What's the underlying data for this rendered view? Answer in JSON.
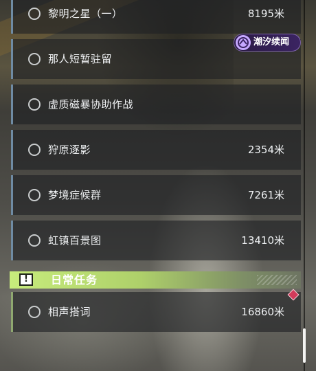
{
  "badge": {
    "label": "潮汐续闻",
    "icon": "tide-event-icon"
  },
  "tasks": [
    {
      "name": "黎明之星（一）",
      "distance": "8195米"
    },
    {
      "name": "那人短暂驻留",
      "distance": ""
    },
    {
      "name": "虚质磁暴协助作战",
      "distance": ""
    },
    {
      "name": "狩原逐影",
      "distance": "2354米"
    },
    {
      "name": "梦境症候群",
      "distance": "7261米"
    },
    {
      "name": "虹镇百景图",
      "distance": "13410米"
    }
  ],
  "daily_section": {
    "title": "日常任务",
    "icon_mark": "!",
    "tasks": [
      {
        "name": "相声搭词",
        "distance": "16860米"
      }
    ]
  },
  "colors": {
    "main_quest_accent": "#6f8ba3",
    "daily_accent": "#c7ec7c",
    "track_marker": "#d23a5a",
    "badge_bg": "#3b2462"
  }
}
